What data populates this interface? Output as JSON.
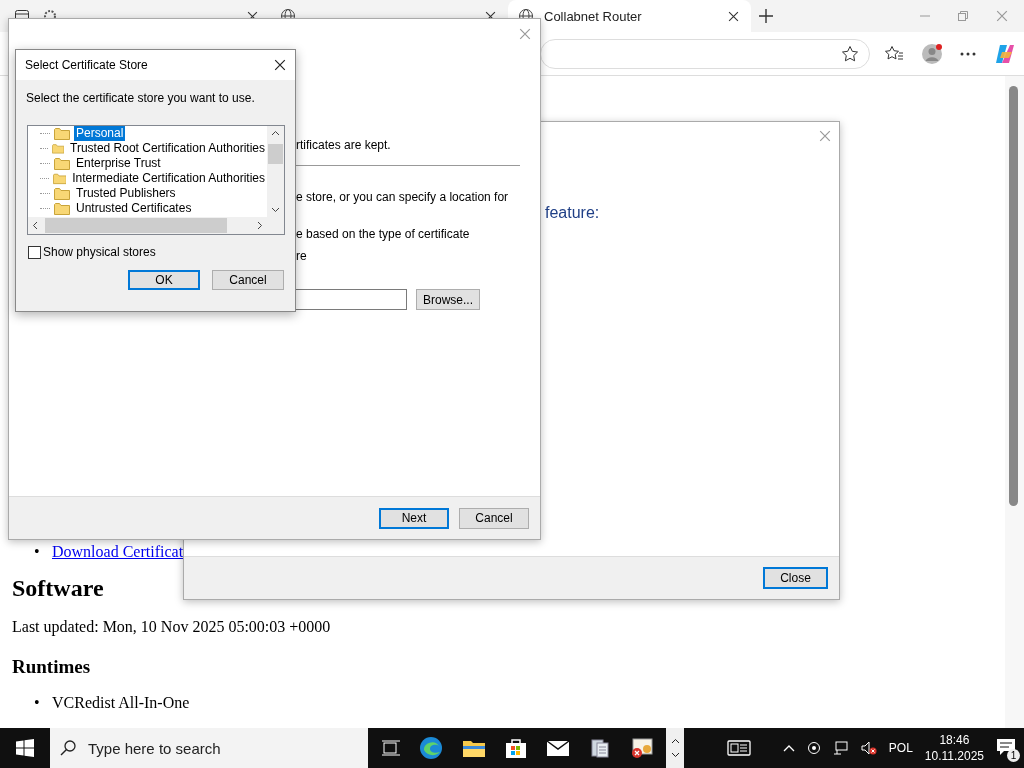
{
  "browser": {
    "tabs": [
      {
        "selected": false
      },
      {
        "selected": false
      },
      {
        "label": "Collabnet Router",
        "selected": true
      }
    ]
  },
  "page": {
    "bullet": "•",
    "link": "Download Certificat",
    "heading": "Software",
    "updated": "Last updated: Mon, 10 Nov 2025 05:00:03 +0000",
    "subheading": "Runtimes",
    "items": [
      "VCRedist All-In-One"
    ]
  },
  "info_dialog": {
    "text": "feature:",
    "button": "Close"
  },
  "wizard": {
    "lines": [
      "rtificates are kept.",
      "e store, or you can specify a location for",
      "e based on the type of certificate",
      "re"
    ],
    "browse": "Browse...",
    "next": "Next",
    "cancel": "Cancel"
  },
  "store_dialog": {
    "title": "Select Certificate Store",
    "prompt": "Select the certificate store you want to use.",
    "stores": [
      {
        "label": "Personal",
        "selected": true
      },
      {
        "label": "Trusted Root Certification Authorities",
        "selected": false
      },
      {
        "label": "Enterprise Trust",
        "selected": false
      },
      {
        "label": "Intermediate Certification Authorities",
        "selected": false
      },
      {
        "label": "Trusted Publishers",
        "selected": false
      },
      {
        "label": "Untrusted Certificates",
        "selected": false
      }
    ],
    "show_physical": {
      "label": "Show physical stores",
      "checked": false
    },
    "ok": "OK",
    "cancel": "Cancel"
  },
  "taskbar": {
    "search_placeholder": "Type here to search",
    "language": "POL",
    "time": "18:46",
    "date": "10.11.2025",
    "notifications": "1"
  }
}
